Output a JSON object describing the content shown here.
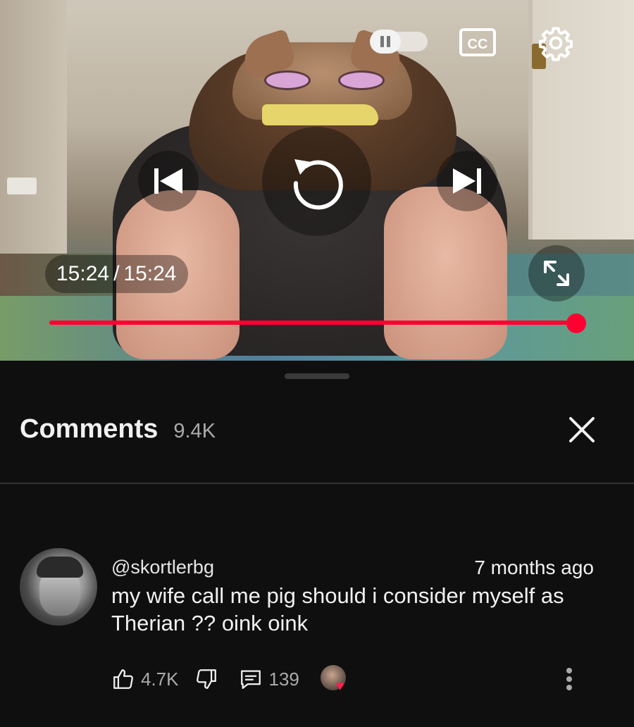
{
  "player": {
    "current_time": "15:24",
    "separator": "/",
    "duration": "15:24",
    "progress_fraction": 1.0,
    "autoplay_state": "on",
    "accent_color": "#ff0033",
    "icons": {
      "pause": "pause-icon",
      "cc": "closed-captions-icon",
      "settings": "gear-icon",
      "prev": "skip-previous-icon",
      "replay": "replay-icon",
      "next": "skip-next-icon",
      "fullscreen": "fullscreen-icon"
    }
  },
  "comments": {
    "title": "Comments",
    "count": "9.4K",
    "items": [
      {
        "author": "@skortlerbg",
        "time_ago": "7 months ago",
        "text": "my wife call me pig should i consider myself as Therian ??  oink oink",
        "likes": "4.7K",
        "replies": "139",
        "creator_hearted": true
      }
    ]
  }
}
